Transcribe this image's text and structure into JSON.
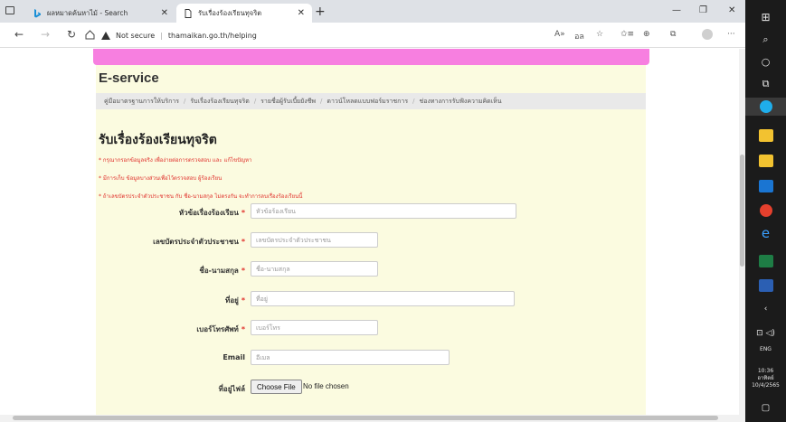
{
  "browser": {
    "tabs": [
      {
        "label": "ผลหมาดค้นหาไม้ - Search",
        "icon": "bing-icon"
      },
      {
        "label": "รับเรื่องร้องเรียนทุจริต",
        "icon": "page-icon"
      }
    ],
    "address": {
      "security_label": "Not secure",
      "url": "thamaikan.go.th/helping"
    }
  },
  "page": {
    "section_title": "E-service",
    "breadcrumb": [
      "คู่มือมาตรฐานการให้บริการ",
      "รับเรื่องร้องเรียนทุจริต",
      "รายชื่อผู้รับเบี้ยยังชีพ",
      "ดาวน์โหลดแบบฟอร์มราชการ",
      "ช่องทางการรับฟังความคิดเห็น"
    ],
    "title": "รับเรื่องร้องเรียนทุจริต",
    "notes": [
      "* กรุณากรอกข้อมูลจริง เพื่อง่ายต่อการตรวจสอบ และ แก้ไขปัญหา",
      "* มีการเก็บ ข้อมูลบางส่วนเพื่อไว้ตรวจสอบ ผู้ร้องเรียน",
      "* ถ้าเลขบัตรประจำตัวประชาชน กับ ชื่อ-นามสกุล ไม่ตรงกัน จะทำการลบเรื่องร้องเรียนนี้"
    ],
    "form": {
      "subject": {
        "label": "หัวข้อเรื่องร้องเรียน",
        "required_mark": "*",
        "placeholder": "หัวข้อร้องเรียน"
      },
      "id_card": {
        "label": "เลขบัตรประจำตัวประชาชน",
        "required_mark": "*",
        "placeholder": "เลขบัตรประจำตัวประชาชน"
      },
      "name": {
        "label": "ชื่อ-นามสกุล",
        "required_mark": "*",
        "placeholder": "ชื่อ-นามสกุล"
      },
      "address": {
        "label": "ที่อยู่",
        "required_mark": "*",
        "placeholder": "ที่อยู่"
      },
      "phone": {
        "label": "เบอร์โทรศัพท์",
        "required_mark": "*",
        "placeholder": "เบอร์โทร"
      },
      "email": {
        "label": "Email",
        "placeholder": "อีเมล"
      },
      "file": {
        "label": "ที่อยู่ไฟล์",
        "button": "Choose File",
        "status": "No file chosen"
      }
    }
  },
  "taskbar": {
    "language": "ENG",
    "time": "10:36",
    "day": "อาทิตย์",
    "date": "10/4/2565"
  }
}
